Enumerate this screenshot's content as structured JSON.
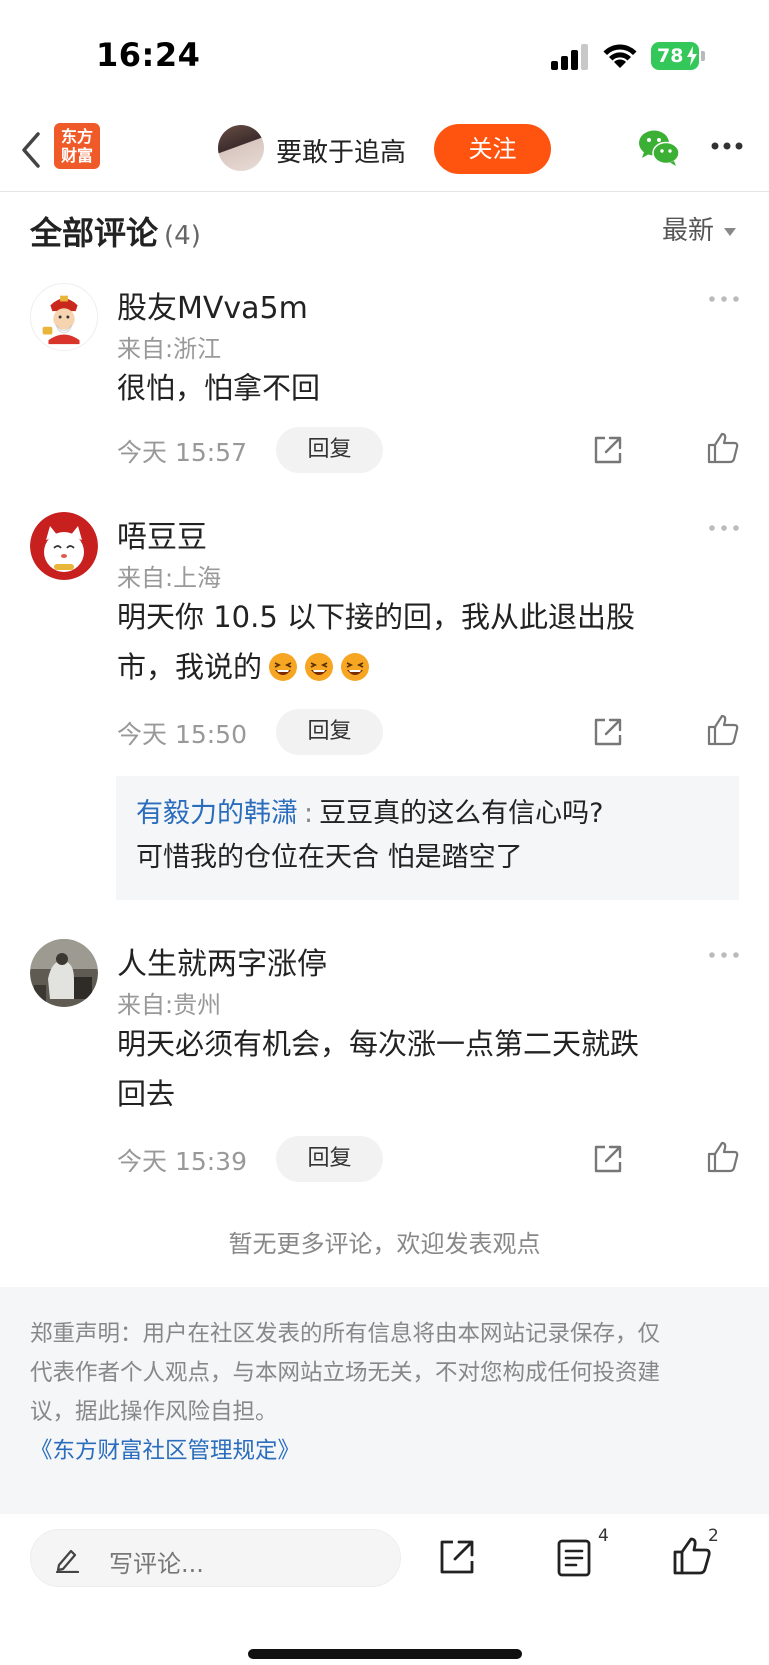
{
  "status_bar": {
    "time": "16:24",
    "battery": "78"
  },
  "nav": {
    "logo_line1": "东方",
    "logo_line2": "财富",
    "username": "要敢于追高",
    "follow_label": "关注"
  },
  "comments_header": {
    "title": "全部评论",
    "count": "(4)",
    "sort_label": "最新"
  },
  "comments": [
    {
      "name": "股友MVva5m",
      "location": "来自:浙江",
      "text_lines": [
        "很怕，怕拿不回"
      ],
      "time": "今天 15:57",
      "reply_label": "回复"
    },
    {
      "name": "唔豆豆",
      "location": "来自:上海",
      "text_lines": [
        "明天你 10.5 以下接的回，我从此退出股",
        "市，我说的"
      ],
      "time": "今天 15:50",
      "reply_label": "回复",
      "sub_reply": {
        "author": "有毅力的韩潇",
        "colon": ":",
        "line1": "豆豆真的这么有信心吗?",
        "line2": "可惜我的仓位在天合 怕是踏空了"
      }
    },
    {
      "name": "人生就两字涨停",
      "location": "来自:贵州",
      "text_lines": [
        "明天必须有机会，每次涨一点第二天就跌",
        "回去"
      ],
      "time": "今天 15:39",
      "reply_label": "回复"
    }
  ],
  "no_more_text": "暂无更多评论，欢迎发表观点",
  "disclaimer": {
    "line1": "郑重声明：用户在社区发表的所有信息将由本网站记录保存，仅",
    "line2": "代表作者个人观点，与本网站立场无关，不对您构成任何投资建",
    "line3": "议，据此操作风险自担。",
    "link": "《东方财富社区管理规定》"
  },
  "bottom_bar": {
    "input_placeholder": "写评论...",
    "comments_badge": "4",
    "likes_badge": "2"
  },
  "colors": {
    "accent": "#ff5410",
    "link": "#2a6dbd",
    "brand": "#f05a28"
  }
}
